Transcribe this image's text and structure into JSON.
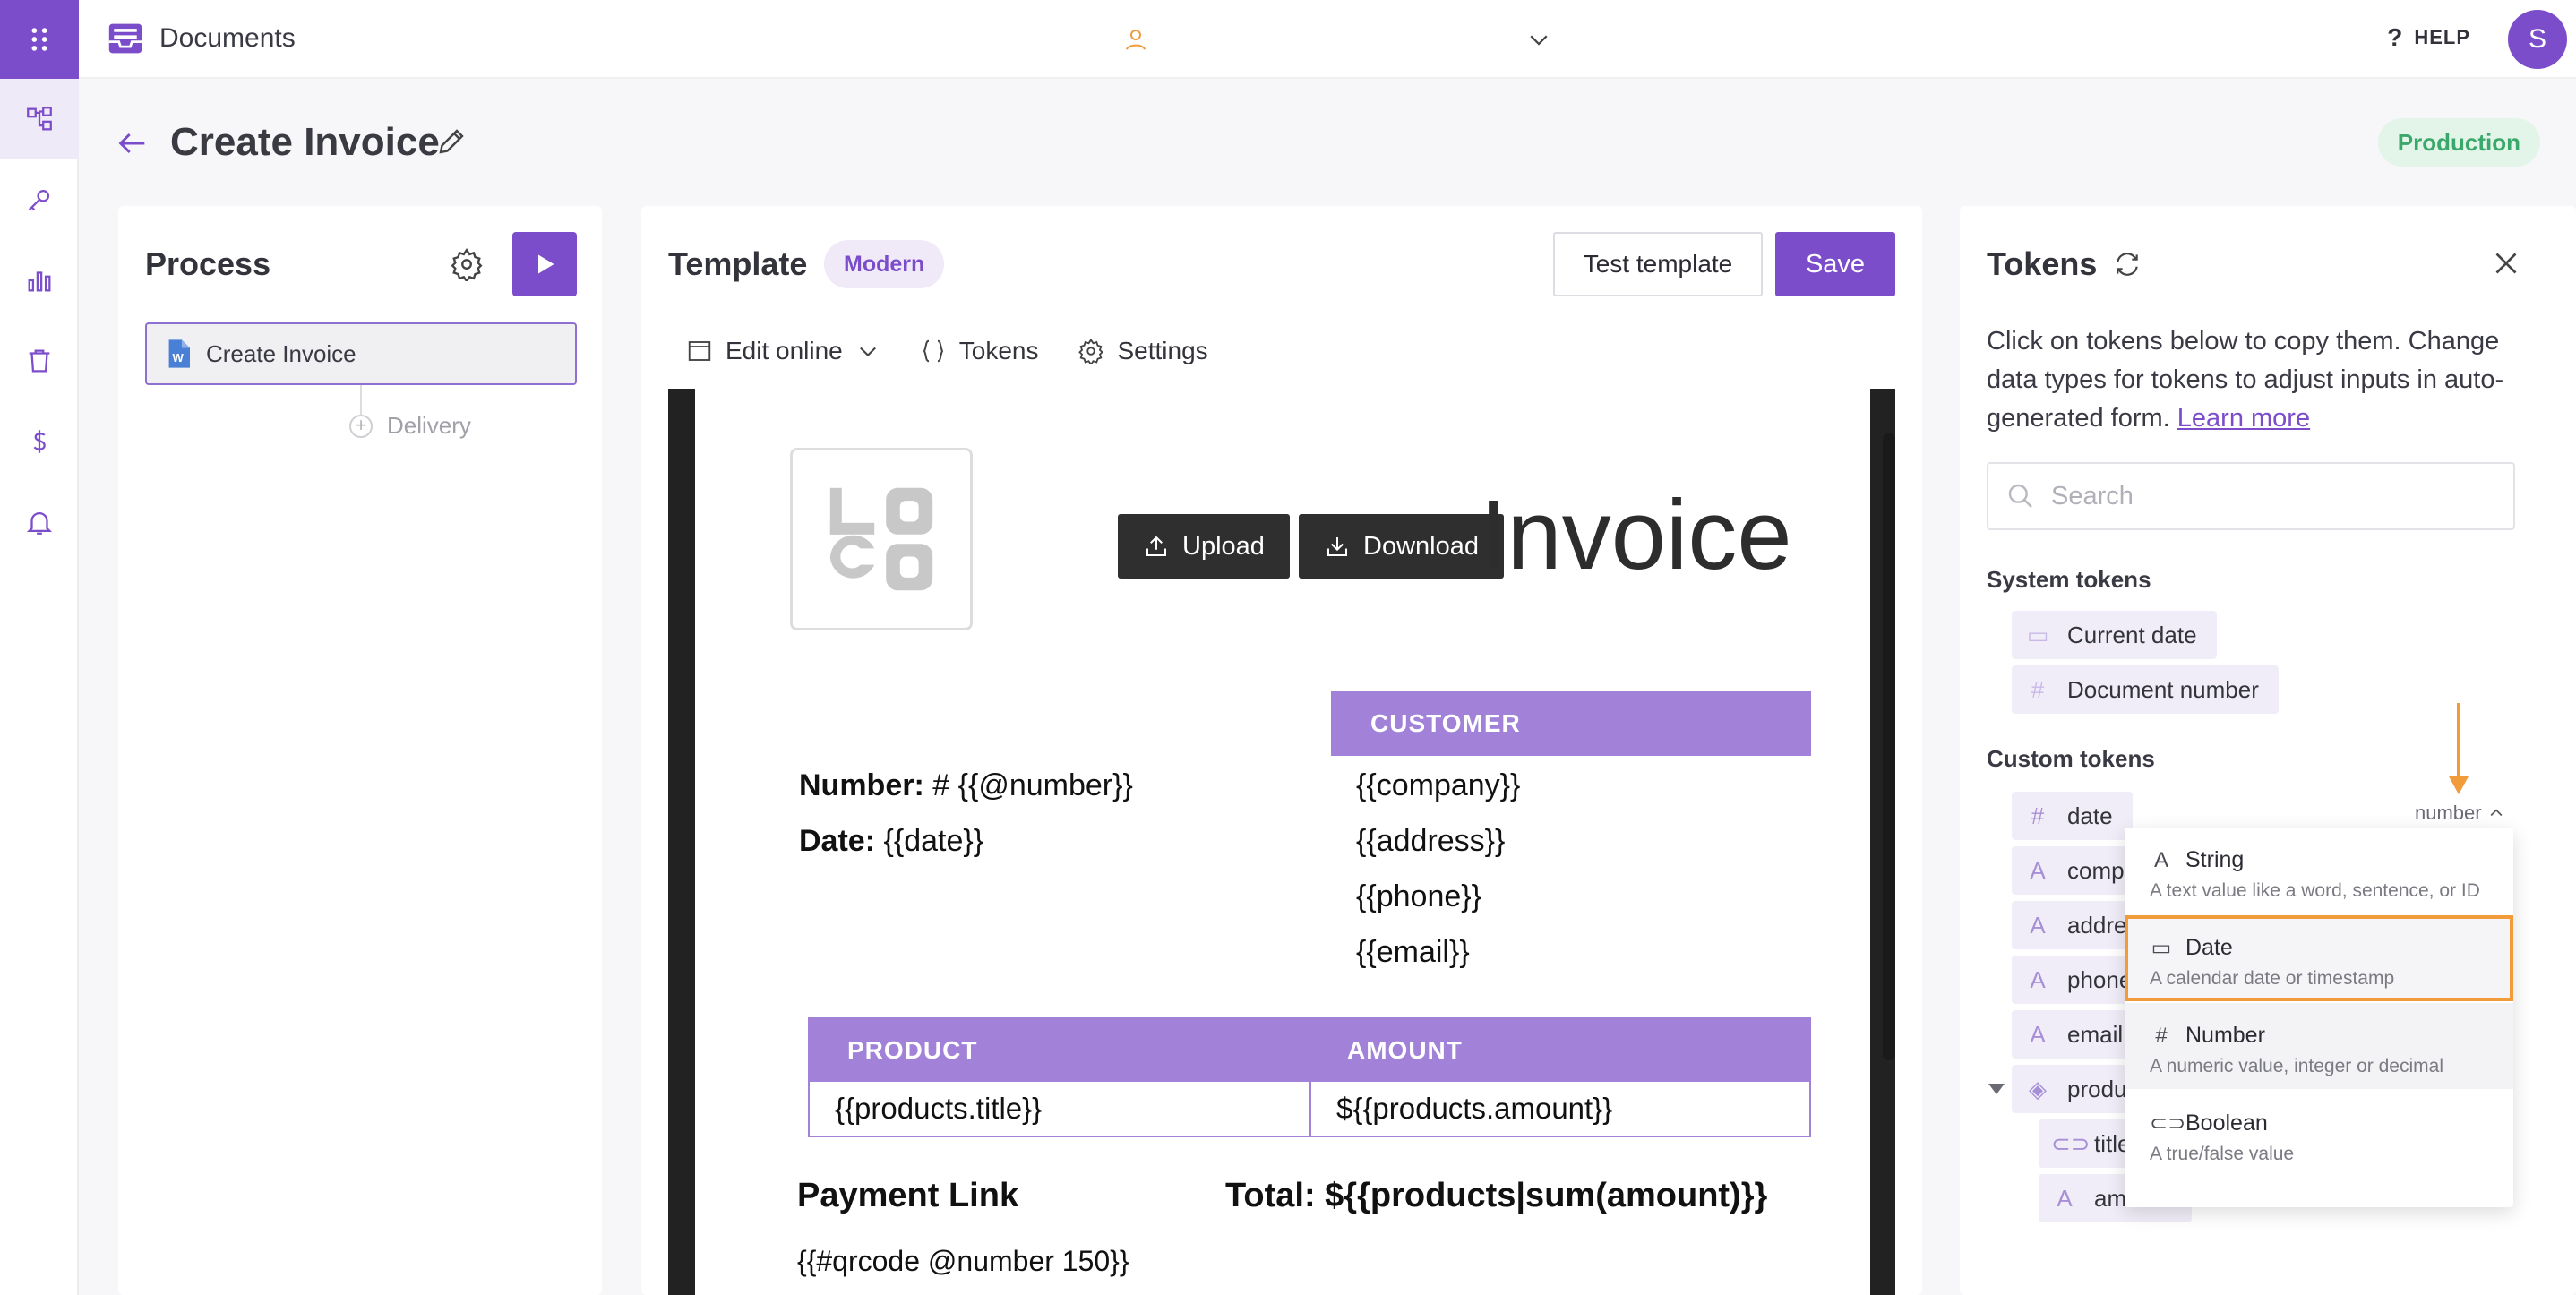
{
  "app": {
    "title": "Documents",
    "help_label": "HELP",
    "avatar_initial": "S",
    "accent_color": "#7c4dca"
  },
  "page": {
    "title": "Create Invoice",
    "environment_badge": "Production"
  },
  "process": {
    "title": "Process",
    "steps": [
      {
        "label": "Create Invoice",
        "icon": "word-document-icon"
      }
    ],
    "add_step_label": "Delivery"
  },
  "template": {
    "title": "Template",
    "style_badge": "Modern",
    "test_button": "Test template",
    "save_button": "Save",
    "toolbar": {
      "edit_online": "Edit online",
      "tokens": "Tokens",
      "settings": "Settings"
    },
    "document": {
      "upload_button": "Upload",
      "download_button": "Download",
      "heading": "Invoice",
      "customer_header": "CUSTOMER",
      "number_label": "Number:",
      "number_value": "# {{@number}}",
      "date_label": "Date:",
      "date_value": "{{date}}",
      "customer_lines": [
        "{{company}}",
        "{{address}}",
        "{{phone}}",
        "{{email}}"
      ],
      "table": {
        "headers": [
          "PRODUCT",
          "AMOUNT"
        ],
        "rows": [
          [
            "{{products.title}}",
            "${{products.amount}}"
          ]
        ]
      },
      "payment_title": "Payment Link",
      "total": "Total: ${{products|sum(amount)}}",
      "qrcode": "{{#qrcode @number 150}}"
    }
  },
  "tokens": {
    "title": "Tokens",
    "description": "Click on tokens below to copy them. Change data types for tokens to adjust inputs in auto-generated form.",
    "learn_more": "Learn more",
    "search_placeholder": "Search",
    "system_title": "System tokens",
    "system": [
      {
        "name": "Current date",
        "icon": "calendar-icon"
      },
      {
        "name": "Document number",
        "icon": "hash-icon"
      }
    ],
    "custom_title": "Custom tokens",
    "custom": [
      {
        "name": "date",
        "icon": "hash-icon"
      },
      {
        "name": "comp",
        "icon": "text-icon"
      },
      {
        "name": "addre",
        "icon": "text-icon"
      },
      {
        "name": "phone",
        "icon": "text-icon"
      },
      {
        "name": "email",
        "icon": "text-icon"
      },
      {
        "name": "produ",
        "icon": "layers-icon"
      },
      {
        "name": "title",
        "icon": "toggle-icon"
      },
      {
        "name": "amount",
        "icon": "text-icon"
      }
    ],
    "type_selector": "number",
    "type_options": [
      {
        "label": "String",
        "desc": "A text value like a word, sentence, or ID",
        "icon": "text-icon"
      },
      {
        "label": "Date",
        "desc": "A calendar date or timestamp",
        "icon": "calendar-icon"
      },
      {
        "label": "Number",
        "desc": "A numeric value, integer or decimal",
        "icon": "hash-icon"
      },
      {
        "label": "Boolean",
        "desc": "A true/false value",
        "icon": "toggle-icon"
      }
    ],
    "highlight_color": "#f29b3a"
  }
}
